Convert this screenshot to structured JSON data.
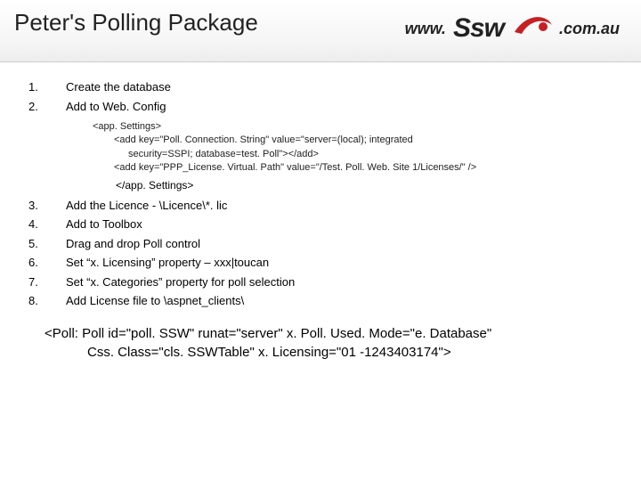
{
  "title": "Peter's Polling Package",
  "logo": {
    "www": "www.",
    "ssw": "Ssw",
    "com": ".com.au"
  },
  "steps": {
    "s1": {
      "num": "1.",
      "text": "Create the database"
    },
    "s2": {
      "num": "2.",
      "text": "Add to Web. Config"
    },
    "code": {
      "open": "<app. Settings>",
      "line1a": "<add key=\"Poll. Connection. String\" value=\"server=(local); integrated",
      "line1b": "security=SSPI; database=test. Poll\"></add>",
      "line2": "<add key=\"PPP_License. Virtual. Path\" value=\"/Test. Poll. Web. Site 1/Licenses/\" />",
      "close": "</app. Settings>"
    },
    "s3": {
      "num": "3.",
      "text": "Add the Licence - \\Licence\\*. lic"
    },
    "s4": {
      "num": "4.",
      "text": "Add to Toolbox"
    },
    "s5": {
      "num": "5.",
      "text": "Drag and drop Poll control"
    },
    "s6": {
      "num": "6.",
      "text": "Set “x. Licensing” property – xxx|toucan"
    },
    "s7": {
      "num": "7.",
      "text": "Set “x. Categories” property for poll selection"
    },
    "s8": {
      "num": "8.",
      "text": "Add License file to \\aspnet_clients\\"
    }
  },
  "snippet": {
    "line1": "<Poll: Poll id=\"poll. SSW\" runat=\"server\" x. Poll. Used. Mode=\"e. Database\"",
    "line2": "Css. Class=\"cls. SSWTable\" x. Licensing=\"01 -1243403174\">"
  }
}
